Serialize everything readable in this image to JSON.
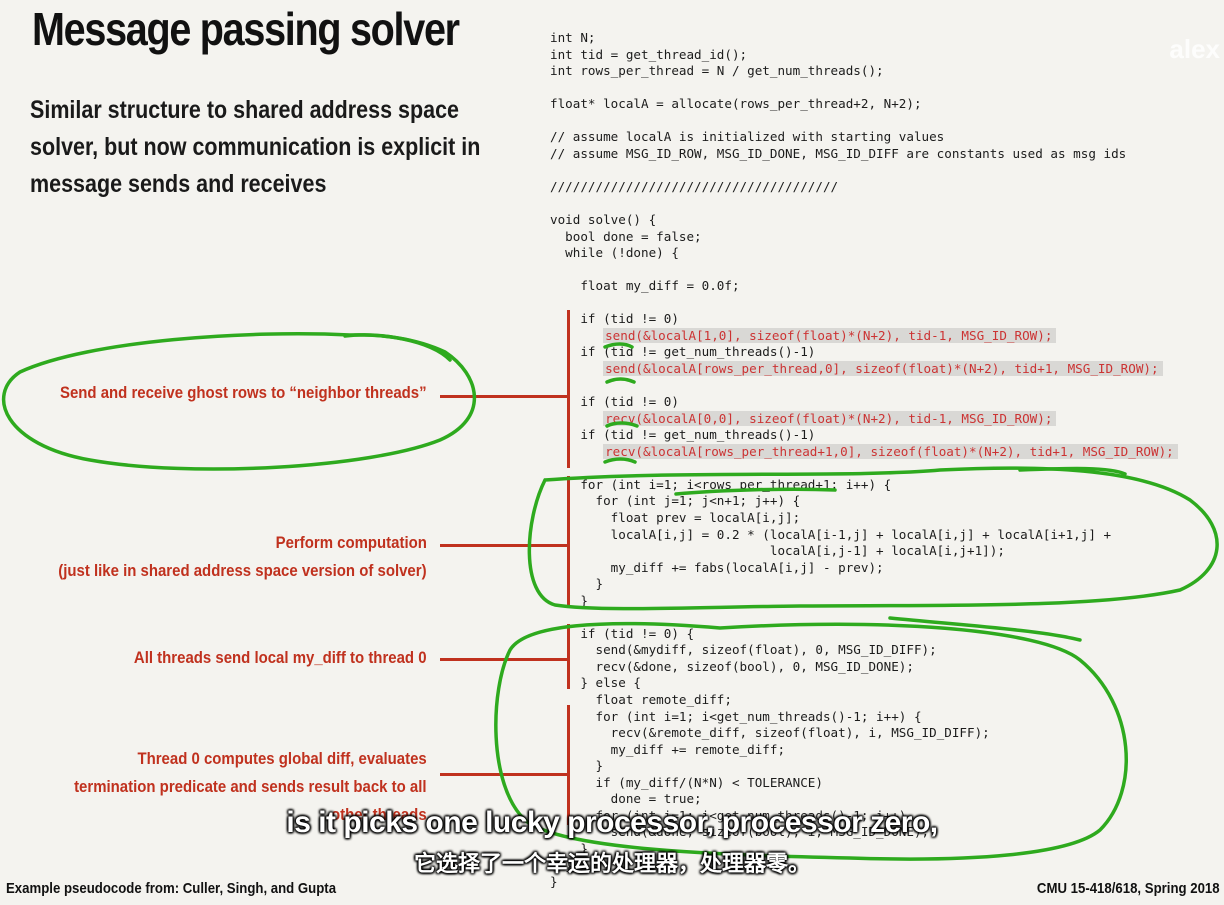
{
  "slide": {
    "title": "Message passing solver",
    "intro": "Similar structure to shared address space solver, but now communication is explicit in message sends and receives",
    "watermark": "alex",
    "footer_left": "Example pseudocode from: Culler, Singh, and Gupta",
    "footer_right": "CMU 15-418/618, Spring 2018"
  },
  "code_lines": [
    {
      "text": "int N;"
    },
    {
      "text": "int tid = get_thread_id();"
    },
    {
      "text": "int rows_per_thread = N / get_num_threads();"
    },
    {
      "text": ""
    },
    {
      "text": "float* localA = allocate(rows_per_thread+2, N+2);"
    },
    {
      "text": ""
    },
    {
      "text": "// assume localA is initialized with starting values"
    },
    {
      "text": "// assume MSG_ID_ROW, MSG_ID_DONE, MSG_ID_DIFF are constants used as msg ids"
    },
    {
      "text": ""
    },
    {
      "text": "//////////////////////////////////////"
    },
    {
      "text": ""
    },
    {
      "text": "void solve() {"
    },
    {
      "text": "  bool done = false;"
    },
    {
      "text": "  while (!done) {"
    },
    {
      "text": ""
    },
    {
      "text": "    float my_diff = 0.0f;"
    },
    {
      "text": ""
    },
    {
      "text": "    if (tid != 0)"
    },
    {
      "text": "send(&localA[1,0], sizeof(float)*(N+2), tid-1, MSG_ID_ROW);",
      "indent": "       ",
      "hl": true
    },
    {
      "text": "    if (tid != get_num_threads()-1)"
    },
    {
      "text": "send(&localA[rows_per_thread,0], sizeof(float)*(N+2), tid+1, MSG_ID_ROW);",
      "indent": "       ",
      "hl": true
    },
    {
      "text": ""
    },
    {
      "text": "    if (tid != 0)"
    },
    {
      "text": "recv(&localA[0,0], sizeof(float)*(N+2), tid-1, MSG_ID_ROW);",
      "indent": "       ",
      "hl": true
    },
    {
      "text": "    if (tid != get_num_threads()-1)"
    },
    {
      "text": "recv(&localA[rows_per_thread+1,0], sizeof(float)*(N+2), tid+1, MSG_ID_ROW);",
      "indent": "       ",
      "hl": true
    },
    {
      "text": ""
    },
    {
      "text": "    for (int i=1; i<rows_per_thread+1; i++) {"
    },
    {
      "text": "      for (int j=1; j<n+1; j++) {"
    },
    {
      "text": "        float prev = localA[i,j];"
    },
    {
      "text": "        localA[i,j] = 0.2 * (localA[i-1,j] + localA[i,j] + localA[i+1,j] +"
    },
    {
      "text": "                             localA[i,j-1] + localA[i,j+1]);"
    },
    {
      "text": "        my_diff += fabs(localA[i,j] - prev);"
    },
    {
      "text": "      }"
    },
    {
      "text": "    }"
    },
    {
      "text": ""
    },
    {
      "text": "    if (tid != 0) {"
    },
    {
      "text": "      send(&mydiff, sizeof(float), 0, MSG_ID_DIFF);"
    },
    {
      "text": "      recv(&done, sizeof(bool), 0, MSG_ID_DONE);"
    },
    {
      "text": "    } else {"
    },
    {
      "text": "      float remote_diff;"
    },
    {
      "text": "      for (int i=1; i<get_num_threads()-1; i++) {"
    },
    {
      "text": "        recv(&remote_diff, sizeof(float), i, MSG_ID_DIFF);"
    },
    {
      "text": "        my_diff += remote_diff;"
    },
    {
      "text": "      }"
    },
    {
      "text": "      if (my_diff/(N*N) < TOLERANCE)"
    },
    {
      "text": "        done = true;"
    },
    {
      "text": "      for (int i=1; i<get_num_threads()-1; i++)"
    },
    {
      "text": "        send(&done, sizeof(bool), i, MSG_ID_DONE);"
    },
    {
      "text": "    }"
    },
    {
      "text": "  }"
    },
    {
      "text": "}"
    }
  ],
  "annotations": [
    {
      "text": "Send and receive ghost rows to “neighbor threads”"
    },
    {
      "line1": "Perform computation",
      "line2": "(just like in shared address space version of solver)"
    },
    {
      "text": "All threads send local my_diff to thread 0"
    },
    {
      "line1": "Thread 0 computes global diff, evaluates",
      "line2": "termination predicate and sends result back to all",
      "line3": "other threads"
    }
  ],
  "subtitles": {
    "english": "is it picks one lucky processor, processor zero,",
    "chinese": "它选择了一个幸运的处理器，处理器零。"
  },
  "colors": {
    "annotation_red": "#c0311e",
    "ink_green": "#2eaa1e",
    "background": "#f4f3ef"
  }
}
